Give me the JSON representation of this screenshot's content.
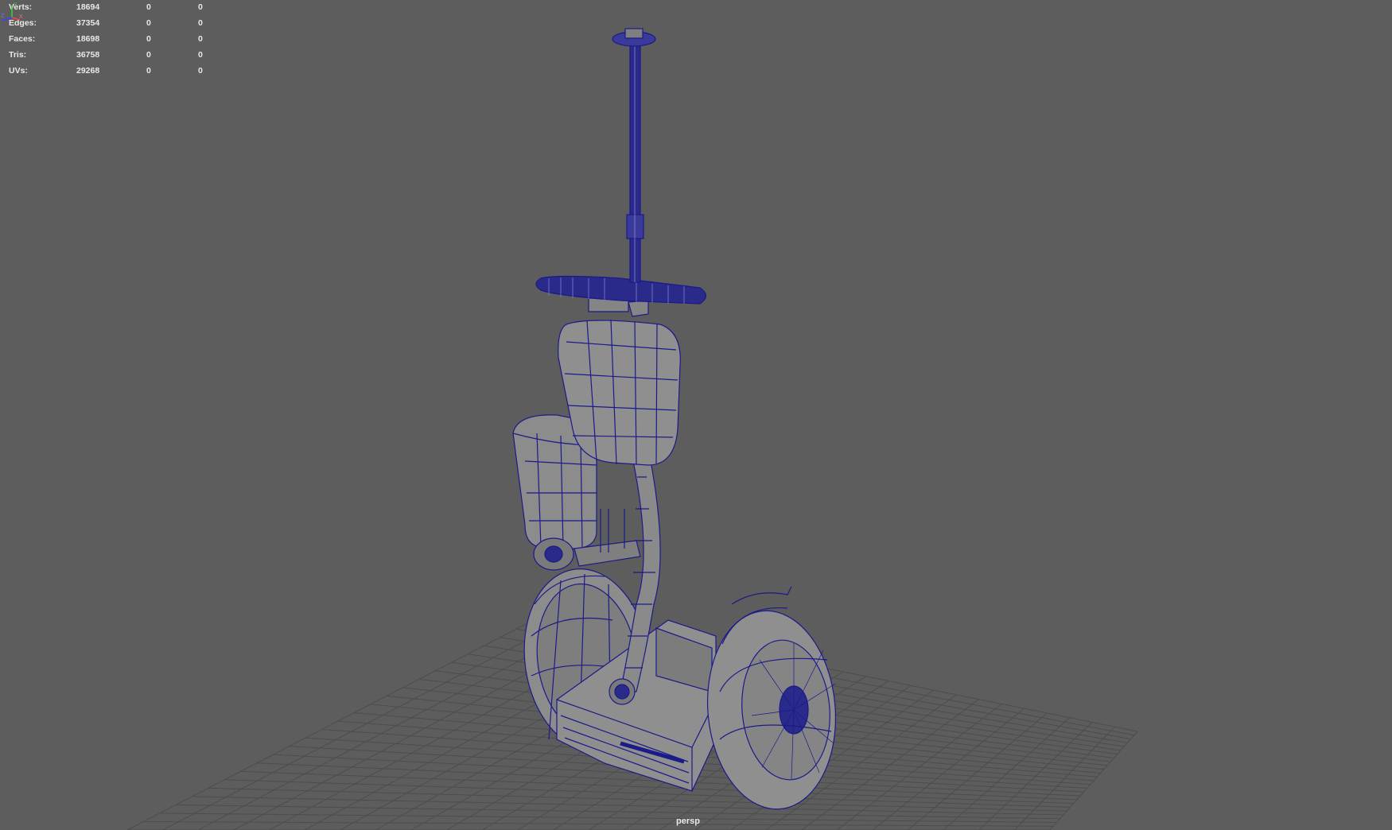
{
  "hud": {
    "rows": [
      {
        "label": "Verts:",
        "total": "18694",
        "selected": "0",
        "component": "0"
      },
      {
        "label": "Edges:",
        "total": "37354",
        "selected": "0",
        "component": "0"
      },
      {
        "label": "Faces:",
        "total": "18698",
        "selected": "0",
        "component": "0"
      },
      {
        "label": "Tris:",
        "total": "36758",
        "selected": "0",
        "component": "0"
      },
      {
        "label": "UVs:",
        "total": "29268",
        "selected": "0",
        "component": "0"
      }
    ]
  },
  "camera": {
    "name": "persp"
  },
  "axis_gizmo": {
    "labels": [
      "Y",
      "Z",
      "X"
    ]
  },
  "colors": {
    "background": "#5d5d5d",
    "grid": "#4e4e4e",
    "wireframe": "#1c1c8c",
    "surface": "#8b8b8b",
    "hud_text": "#e8e8e8"
  }
}
